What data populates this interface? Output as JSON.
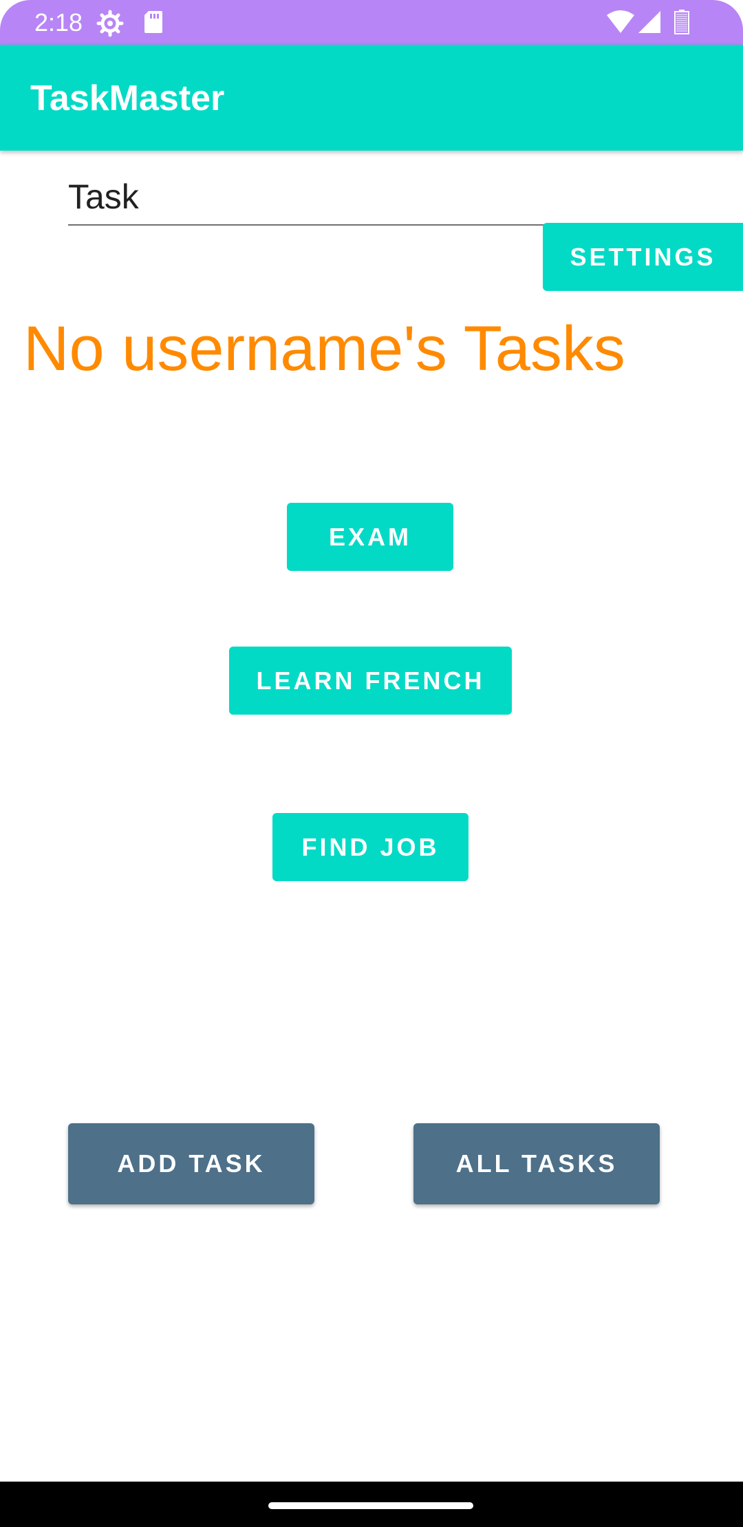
{
  "status_bar": {
    "time": "2:18",
    "icons": [
      "settings-gear-icon",
      "sd-card-icon",
      "wifi-icon",
      "signal-icon",
      "battery-icon"
    ],
    "background_color": "#b885f7"
  },
  "app_bar": {
    "title": "TaskMaster",
    "background_color": "#03dac5"
  },
  "task_input": {
    "value": "Task"
  },
  "settings_button": {
    "label": "SETTINGS"
  },
  "heading": {
    "text": "No username's Tasks",
    "color": "#ff8a00"
  },
  "task_buttons": [
    {
      "label": "EXAM"
    },
    {
      "label": "LEARN FRENCH"
    },
    {
      "label": "FIND JOB"
    }
  ],
  "bottom_buttons": {
    "add_task": "ADD TASK",
    "all_tasks": "ALL TASKS",
    "color": "#4e7089"
  }
}
